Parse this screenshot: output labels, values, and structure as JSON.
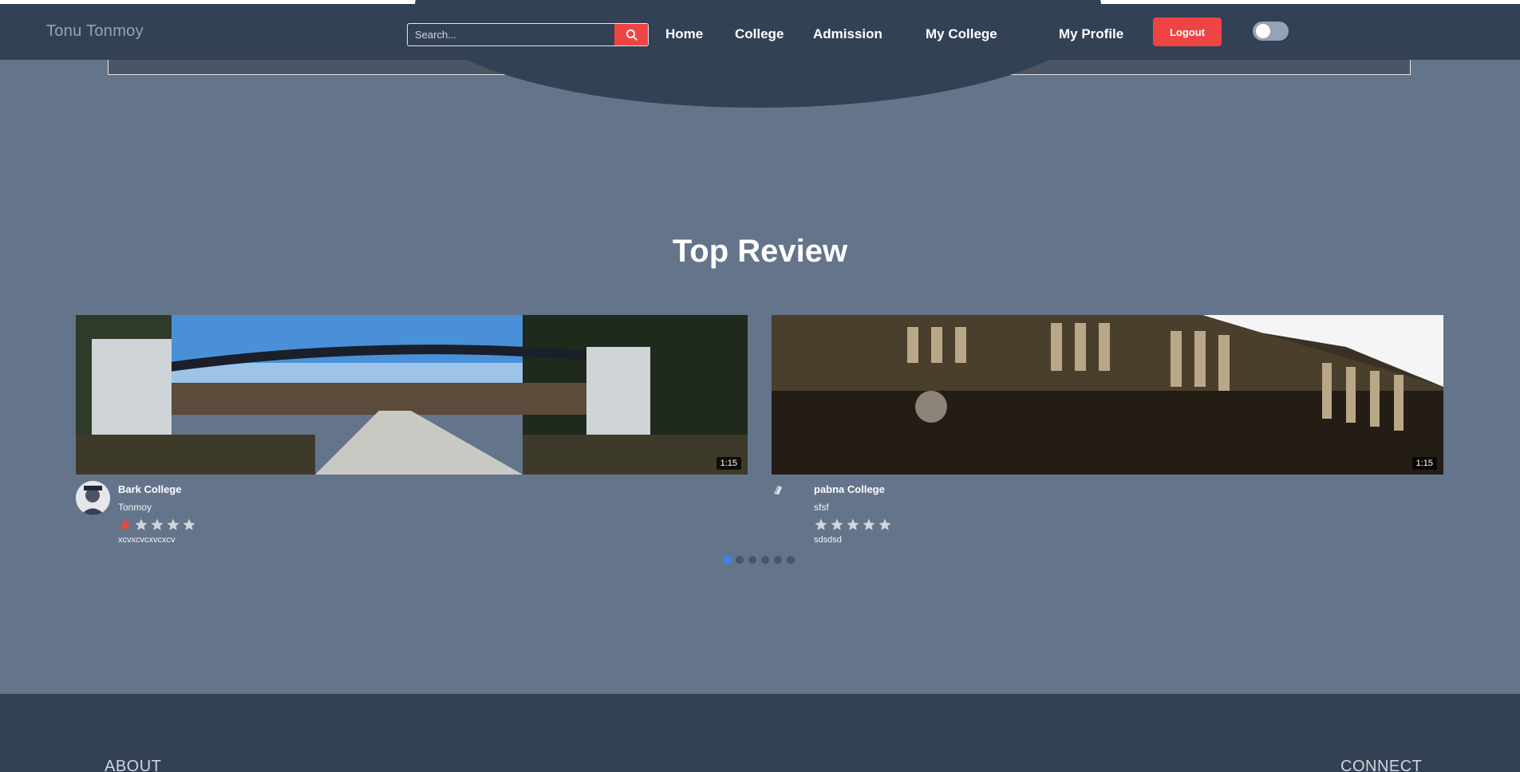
{
  "navbar": {
    "brand": "Tonu Tonmoy",
    "search_placeholder": "Search...",
    "links": [
      "Home",
      "College",
      "Admission",
      "My College",
      "My Profile"
    ],
    "logout_label": "Logout",
    "theme_toggle_on": false
  },
  "colors": {
    "accent": "#ef4444",
    "navbar_bg": "#334155",
    "page_bg": "#64748b",
    "star_active": "#ef4444",
    "star_inactive": "#d1d5db",
    "dot_active": "#3b82f6"
  },
  "top_review": {
    "title": "Top Review",
    "reviews": [
      {
        "college": "Bark College",
        "reviewer": "Tonmoy",
        "rating": 1,
        "max_rating": 5,
        "text": "xcvxcvcxvcxcv",
        "duration": "1:15",
        "image": "university-gate-photo"
      },
      {
        "college": "pabna College",
        "reviewer": "sfsf",
        "rating": 0,
        "max_rating": 5,
        "text": "sdsdsd",
        "duration": "1:15",
        "image": "college-building-photo"
      }
    ],
    "pagination": {
      "pages": 6,
      "current": 1
    }
  },
  "footer": {
    "about_heading": "ABOUT",
    "connect_heading": "CONNECT"
  }
}
